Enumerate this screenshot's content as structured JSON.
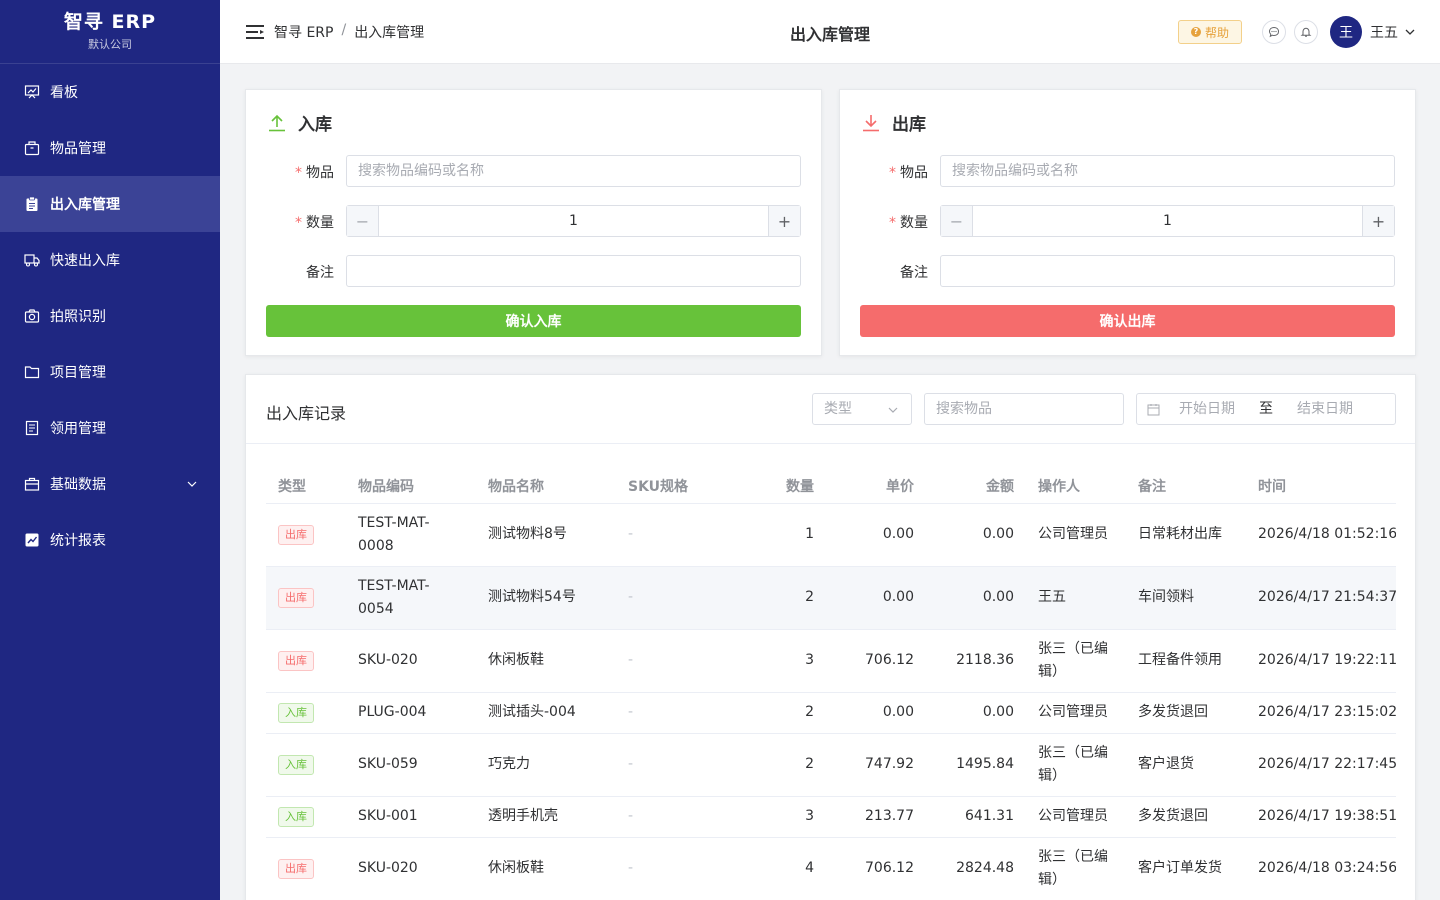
{
  "app": {
    "name": "智寻 ERP",
    "company": "默认公司"
  },
  "sidebar": {
    "items": [
      {
        "label": "看板",
        "icon": "dashboard-icon"
      },
      {
        "label": "物品管理",
        "icon": "box-icon"
      },
      {
        "label": "出入库管理",
        "icon": "clipboard-icon",
        "active": true
      },
      {
        "label": "快速出入库",
        "icon": "truck-icon"
      },
      {
        "label": "拍照识别",
        "icon": "camera-icon"
      },
      {
        "label": "项目管理",
        "icon": "folder-icon"
      },
      {
        "label": "领用管理",
        "icon": "document-icon"
      },
      {
        "label": "基础数据",
        "icon": "briefcase-icon",
        "expandable": true
      },
      {
        "label": "统计报表",
        "icon": "chart-icon"
      }
    ]
  },
  "header": {
    "breadcrumb": [
      "智寻 ERP",
      "/",
      "出入库管理"
    ],
    "title": "出入库管理",
    "help_label": "帮助",
    "help_badge": "?",
    "user": {
      "avatar": "王",
      "name": "王五"
    }
  },
  "inbound": {
    "title": "入库",
    "item_label": "物品",
    "item_placeholder": "搜索物品编码或名称",
    "qty_label": "数量",
    "qty_value": "1",
    "minus": "−",
    "plus": "+",
    "remark_label": "备注",
    "remark_value": "",
    "submit": "确认入库",
    "color": "#67c23a"
  },
  "outbound": {
    "title": "出库",
    "item_label": "物品",
    "item_placeholder": "搜索物品编码或名称",
    "qty_label": "数量",
    "qty_value": "1",
    "minus": "−",
    "plus": "+",
    "remark_label": "备注",
    "remark_value": "",
    "submit": "确认出库",
    "color": "#f56c6c"
  },
  "records": {
    "title": "出入库记录",
    "type_placeholder": "类型",
    "search_placeholder": "搜索物品",
    "date_start": "开始日期",
    "date_sep": "至",
    "date_end": "结束日期",
    "columns": [
      "类型",
      "物品编码",
      "物品名称",
      "SKU规格",
      "数量",
      "单价",
      "金额",
      "操作人",
      "备注",
      "时间"
    ],
    "rows": [
      {
        "type": "出库",
        "code": "TEST-MAT-0008",
        "name": "测试物料8号",
        "sku": "-",
        "qty": "1",
        "price": "0.00",
        "amount": "0.00",
        "operator": "公司管理员",
        "remark": "日常耗材出库",
        "time": "2026/4/18 01:52:16"
      },
      {
        "type": "出库",
        "code": "TEST-MAT-0054",
        "name": "测试物料54号",
        "sku": "-",
        "qty": "2",
        "price": "0.00",
        "amount": "0.00",
        "operator": "王五",
        "remark": "车间领料",
        "time": "2026/4/17 21:54:37"
      },
      {
        "type": "出库",
        "code": "SKU-020",
        "name": "休闲板鞋",
        "sku": "-",
        "qty": "3",
        "price": "706.12",
        "amount": "2118.36",
        "operator": "张三（已编辑）",
        "remark": "工程备件领用",
        "time": "2026/4/17 19:22:11"
      },
      {
        "type": "入库",
        "code": "PLUG-004",
        "name": "测试插头-004",
        "sku": "-",
        "qty": "2",
        "price": "0.00",
        "amount": "0.00",
        "operator": "公司管理员",
        "remark": "多发货退回",
        "time": "2026/4/17 23:15:02"
      },
      {
        "type": "入库",
        "code": "SKU-059",
        "name": "巧克力",
        "sku": "-",
        "qty": "2",
        "price": "747.92",
        "amount": "1495.84",
        "operator": "张三（已编辑）",
        "remark": "客户退货",
        "time": "2026/4/17 22:17:45"
      },
      {
        "type": "入库",
        "code": "SKU-001",
        "name": "透明手机壳",
        "sku": "-",
        "qty": "3",
        "price": "213.77",
        "amount": "641.31",
        "operator": "公司管理员",
        "remark": "多发货退回",
        "time": "2026/4/17 19:38:51"
      },
      {
        "type": "出库",
        "code": "SKU-020",
        "name": "休闲板鞋",
        "sku": "-",
        "qty": "4",
        "price": "706.12",
        "amount": "2824.48",
        "operator": "张三（已编辑）",
        "remark": "客户订单发货",
        "time": "2026/4/18 03:24:56"
      }
    ]
  }
}
